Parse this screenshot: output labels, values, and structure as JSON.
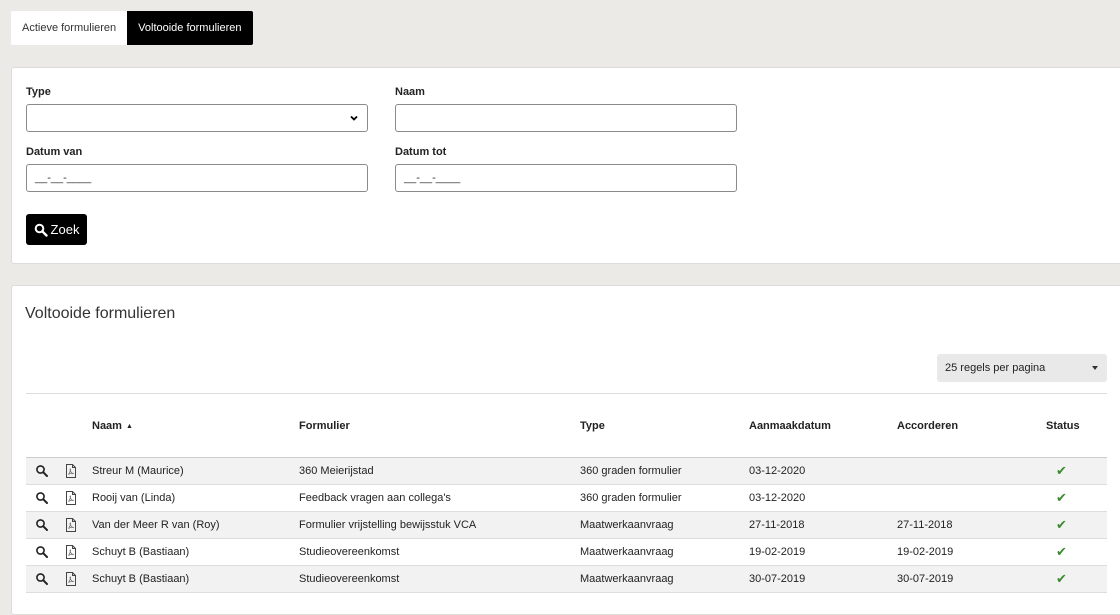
{
  "tabs": [
    {
      "label": "Actieve formulieren"
    },
    {
      "label": "Voltooide formulieren"
    }
  ],
  "filters": {
    "type_label": "Type",
    "type_value": "",
    "naam_label": "Naam",
    "naam_value": "",
    "datum_van_label": "Datum van",
    "datum_van_value": "__-__-____",
    "datum_tot_label": "Datum tot",
    "datum_tot_value": "__-__-____",
    "search_label": "Zoek"
  },
  "list": {
    "title": "Voltooide formulieren",
    "per_page": "25 regels per pagina",
    "columns": {
      "naam": "Naam",
      "formulier": "Formulier",
      "type": "Type",
      "aanmaakdatum": "Aanmaakdatum",
      "accorderen": "Accorderen",
      "status": "Status"
    },
    "rows": [
      {
        "naam": "Streur M (Maurice)",
        "formulier": "360 Meierijstad",
        "type": "360 graden formulier",
        "aanmaakdatum": "03-12-2020",
        "accorderen": "",
        "status": "✔"
      },
      {
        "naam": "Rooij van (Linda)",
        "formulier": "Feedback vragen aan collega's",
        "type": "360 graden formulier",
        "aanmaakdatum": "03-12-2020",
        "accorderen": "",
        "status": "✔"
      },
      {
        "naam": "Van der Meer R van (Roy)",
        "formulier": "Formulier vrijstelling bewijsstuk VCA",
        "type": "Maatwerkaanvraag",
        "aanmaakdatum": "27-11-2018",
        "accorderen": "27-11-2018",
        "status": "✔"
      },
      {
        "naam": "Schuyt B (Bastiaan)",
        "formulier": "Studieovereenkomst",
        "type": "Maatwerkaanvraag",
        "aanmaakdatum": "19-02-2019",
        "accorderen": "19-02-2019",
        "status": "✔"
      },
      {
        "naam": "Schuyt B (Bastiaan)",
        "formulier": "Studieovereenkomst",
        "type": "Maatwerkaanvraag",
        "aanmaakdatum": "30-07-2019",
        "accorderen": "30-07-2019",
        "status": "✔"
      }
    ]
  },
  "colors": {
    "accent": "#000000",
    "status_ok": "#3a8a2e",
    "background": "#ebeae7"
  },
  "icons": {
    "view": "magnifier-icon",
    "pdf": "pdf-file-icon",
    "status": "checkmark-icon",
    "search": "search-icon"
  }
}
